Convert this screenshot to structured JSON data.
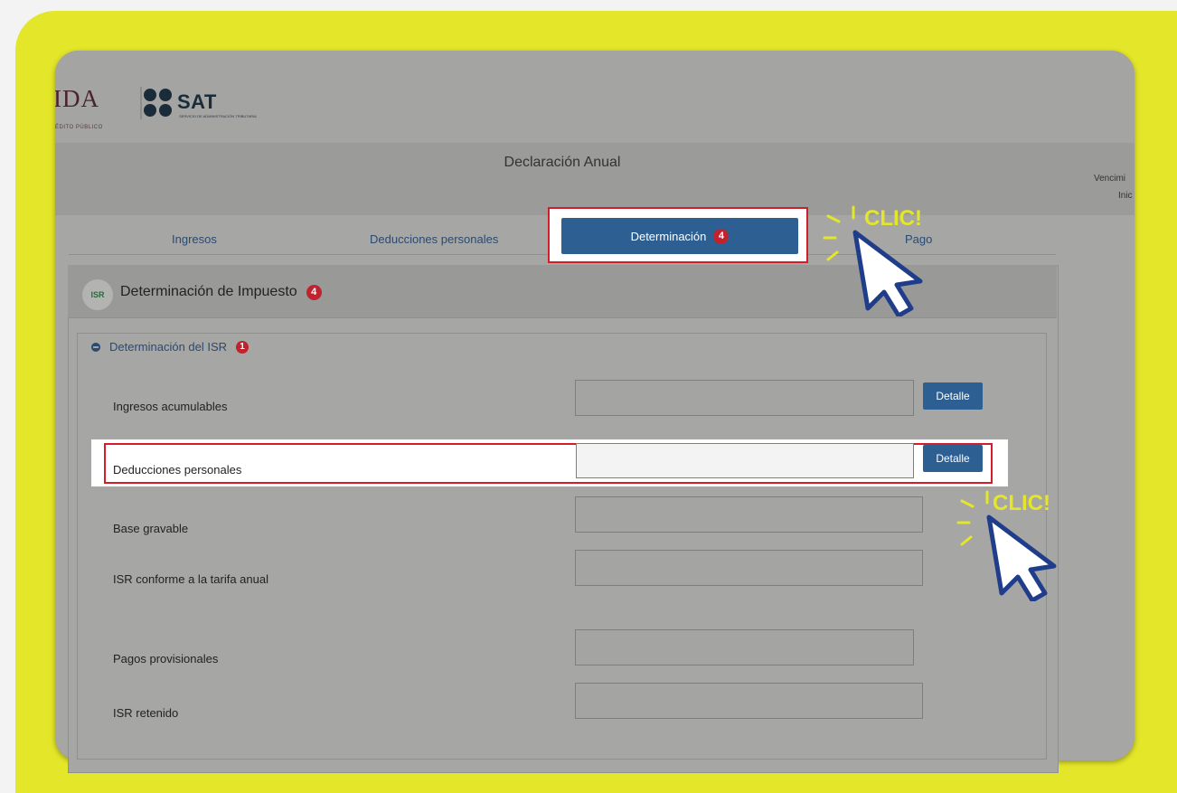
{
  "header": {
    "logo_left_text": "IDA",
    "logo_left_sub": "ÉDITO PÚBLICO",
    "logo_right_text": "SAT",
    "logo_right_sub": "SERVICIO DE ADMINISTRACIÓN TRIBUTARIA",
    "page_title": "Declaración Anual",
    "side_info_1": "Vencimi",
    "side_info_2": "Inic"
  },
  "tabs": [
    {
      "label": "Ingresos"
    },
    {
      "label": "Deducciones personales"
    },
    {
      "label": "Determinación",
      "badge": "4"
    },
    {
      "label": "Pago"
    }
  ],
  "section": {
    "icon_text": "ISR",
    "title": "Determinación de Impuesto",
    "badge": "4",
    "subsection_title": "Determinación del ISR",
    "subsection_badge": "1"
  },
  "rows": [
    {
      "label": "Ingresos acumulables",
      "button": "Detalle"
    },
    {
      "label": "Deducciones personales",
      "button": "Detalle"
    },
    {
      "label": "Base gravable"
    },
    {
      "label": "ISR conforme a la tarifa anual"
    },
    {
      "label": "Pagos provisionales"
    },
    {
      "label": "ISR retenido"
    }
  ],
  "annotations": {
    "clic_1": "CLIC!",
    "clic_2": "CLIC!"
  },
  "colors": {
    "frame_yellow": "#e4e629",
    "active_tab_blue": "#2d5f92",
    "highlight_red": "#d21e2a",
    "badge_red": "#c0222e",
    "cursor_blue": "#1f3d8a"
  }
}
